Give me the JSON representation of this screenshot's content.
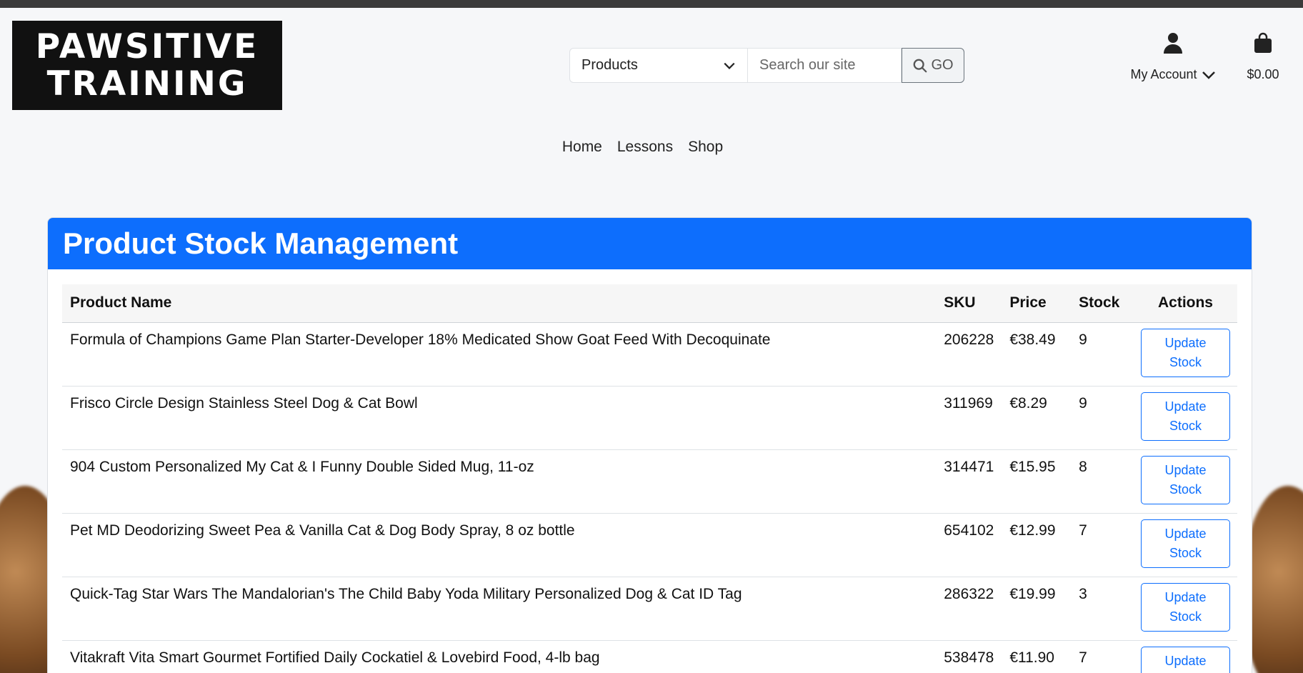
{
  "brand": {
    "logo_text": "PAWSITIVE\nTRAINING"
  },
  "search": {
    "category_selected": "Products",
    "placeholder": "Search our site",
    "go_label": "GO"
  },
  "account": {
    "label": "My Account"
  },
  "cart": {
    "amount": "$0.00"
  },
  "nav": [
    {
      "label": "Home"
    },
    {
      "label": "Lessons"
    },
    {
      "label": "Shop"
    }
  ],
  "panel": {
    "title": "Product Stock Management",
    "columns": [
      "Product Name",
      "SKU",
      "Price",
      "Stock",
      "Actions"
    ],
    "update_label": "Update\nStock",
    "rows": [
      {
        "name": "Formula of Champions Game Plan Starter-Developer 18% Medicated Show Goat Feed With Decoquinate",
        "sku": "206228",
        "price": "€38.49",
        "stock": "9"
      },
      {
        "name": "Frisco Circle Design Stainless Steel Dog & Cat Bowl",
        "sku": "311969",
        "price": "€8.29",
        "stock": "9"
      },
      {
        "name": "904 Custom Personalized My Cat & I Funny Double Sided Mug, 11-oz",
        "sku": "314471",
        "price": "€15.95",
        "stock": "8"
      },
      {
        "name": "Pet MD Deodorizing Sweet Pea & Vanilla Cat & Dog Body Spray, 8 oz bottle",
        "sku": "654102",
        "price": "€12.99",
        "stock": "7"
      },
      {
        "name": "Quick-Tag Star Wars The Mandalorian's The Child Baby Yoda Military Personalized Dog & Cat ID Tag",
        "sku": "286322",
        "price": "€19.99",
        "stock": "3"
      },
      {
        "name": "Vitakraft Vita Smart Gourmet Fortified Daily Cockatiel & Lovebird Food, 4-lb bag",
        "sku": "538478",
        "price": "€11.90",
        "stock": "7"
      }
    ]
  },
  "colors": {
    "primary": "#0d6efd",
    "logo_bg": "#111111",
    "page_bg": "#f6f7f9"
  }
}
